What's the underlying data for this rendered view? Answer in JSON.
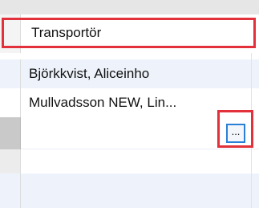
{
  "column": {
    "header": "Transportör"
  },
  "rows": [
    {
      "value": "Björkkvist, Aliceinho"
    },
    {
      "value": "Mullvadsson NEW, Lin..."
    },
    {
      "value": ""
    },
    {
      "value": ""
    },
    {
      "value": ""
    }
  ],
  "ellipsis_button": {
    "label": "..."
  }
}
